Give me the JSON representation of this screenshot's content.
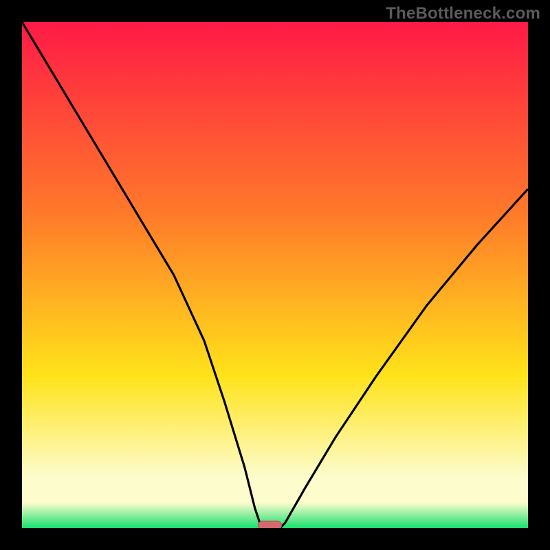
{
  "watermark": "TheBottleneck.com",
  "colors": {
    "frame": "#000000",
    "gradient_top": "#ff1a46",
    "gradient_mid1": "#ff7a2a",
    "gradient_mid2": "#ffe31a",
    "gradient_pale": "#fdfccd",
    "gradient_green": "#17e06f",
    "curve": "#000000",
    "marker_fill": "#d36a6f",
    "marker_stroke": "#b94f54"
  },
  "chart_data": {
    "type": "line",
    "title": "",
    "xlabel": "",
    "ylabel": "",
    "xlim": [
      0,
      100
    ],
    "ylim": [
      0,
      100
    ],
    "series": [
      {
        "name": "bottleneck-curve",
        "x": [
          0,
          6,
          12,
          18,
          24,
          30,
          36,
          40,
          44,
          46,
          47,
          48,
          49,
          50,
          51,
          52,
          56,
          62,
          70,
          80,
          90,
          100
        ],
        "values": [
          100,
          90,
          80,
          70,
          60,
          50,
          37,
          25,
          12,
          4,
          1,
          0,
          0,
          0,
          0,
          1,
          8,
          18,
          30,
          44,
          56,
          67
        ]
      }
    ],
    "annotations": [
      {
        "name": "optimal-marker",
        "x": 49,
        "y": 0,
        "shape": "pill"
      }
    ],
    "gradient_stops_pct": [
      0,
      38,
      70,
      90,
      95,
      100
    ]
  }
}
